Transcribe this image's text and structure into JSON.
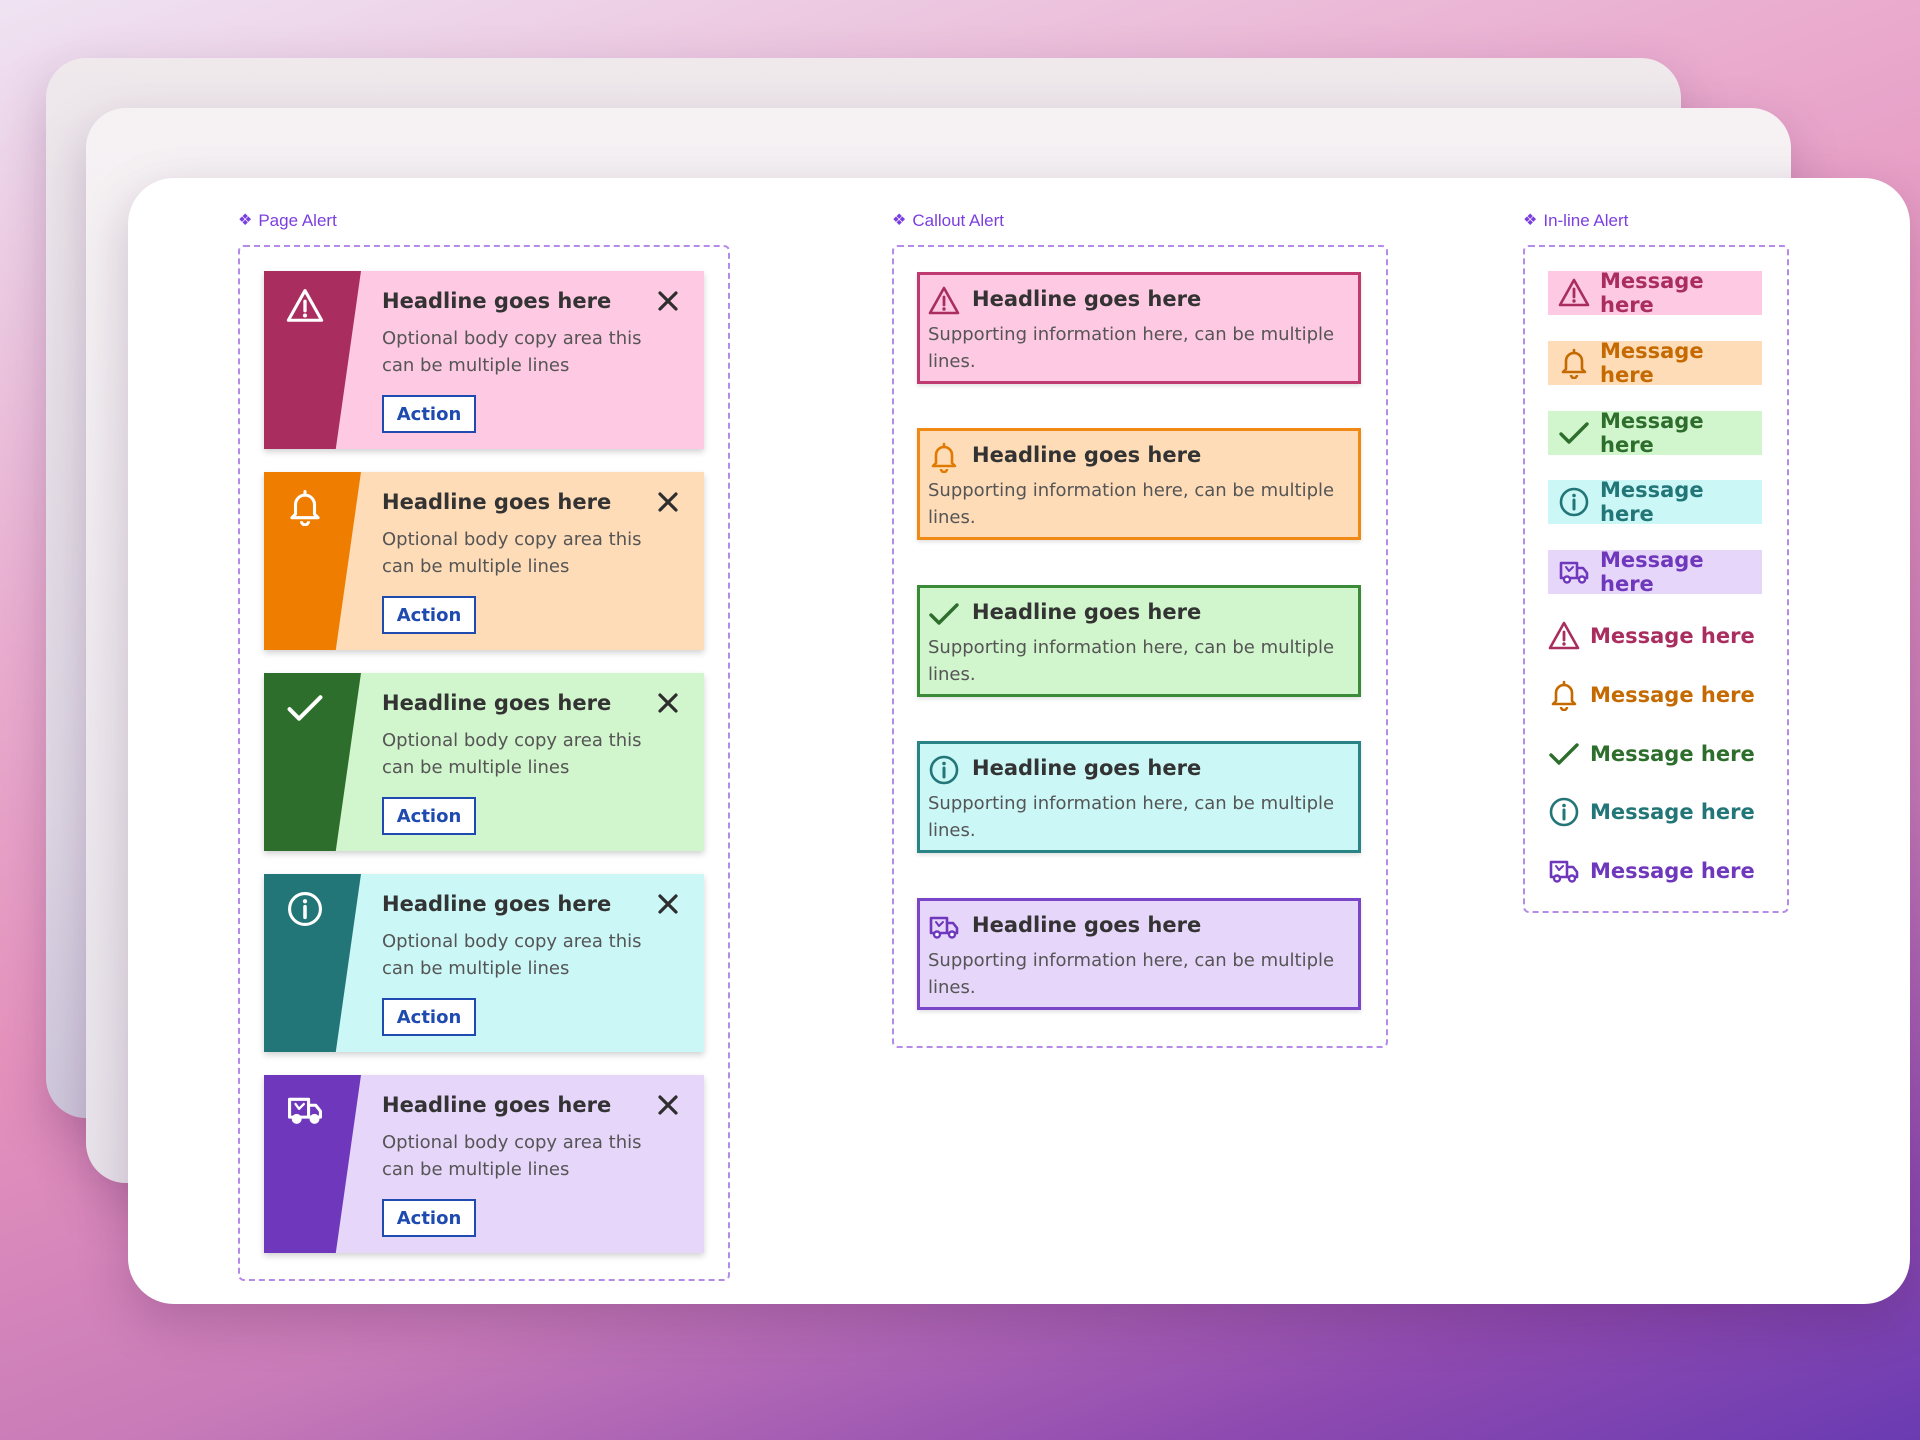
{
  "sections": {
    "page_alert": "Page Alert",
    "callout_alert": "Callout Alert",
    "inline_alert": "In-line Alert"
  },
  "page_alerts": [
    {
      "headline": "Headline goes here",
      "body": "Optional body copy area this can be multiple lines",
      "action": "Action",
      "icon": "warning-icon",
      "accent": "#a92e5f",
      "bg": "#fec9e2"
    },
    {
      "headline": "Headline goes here",
      "body": "Optional body copy area this can be multiple lines",
      "action": "Action",
      "icon": "bell-icon",
      "accent": "#ef7d00",
      "bg": "#fedcb8"
    },
    {
      "headline": "Headline goes here",
      "body": "Optional body copy area this can be multiple lines",
      "action": "Action",
      "icon": "check-icon",
      "accent": "#2e6e2d",
      "bg": "#d1f5cc"
    },
    {
      "headline": "Headline goes here",
      "body": "Optional body copy area this can be multiple lines",
      "action": "Action",
      "icon": "info-icon",
      "accent": "#237677",
      "bg": "#cbf7f7"
    },
    {
      "headline": "Headline goes here",
      "body": "Optional body copy area this can be multiple lines",
      "action": "Action",
      "icon": "truck-icon",
      "accent": "#6f37bb",
      "bg": "#e6d6fa"
    }
  ],
  "callout_alerts": [
    {
      "headline": "Headline goes here",
      "body": "Supporting information here, can be multiple lines.",
      "icon": "warning-icon",
      "border": "#c03a72",
      "icon_color": "#a92e5f",
      "bg": "#fec9e2"
    },
    {
      "headline": "Headline goes here",
      "body": "Supporting information here, can be multiple lines.",
      "icon": "bell-icon",
      "border": "#f08a14",
      "icon_color": "#e07a00",
      "bg": "#fedcb8"
    },
    {
      "headline": "Headline goes here",
      "body": "Supporting information here, can be multiple lines.",
      "icon": "check-icon",
      "border": "#3a8a38",
      "icon_color": "#2e6e2d",
      "bg": "#d1f5cc"
    },
    {
      "headline": "Headline goes here",
      "body": "Supporting information here, can be multiple lines.",
      "icon": "info-icon",
      "border": "#2a8384",
      "icon_color": "#237677",
      "bg": "#cbf7f7"
    },
    {
      "headline": "Headline goes here",
      "body": "Supporting information here, can be multiple lines.",
      "icon": "truck-icon",
      "border": "#7a45c8",
      "icon_color": "#6f37bb",
      "bg": "#e6d6fa"
    }
  ],
  "inline_alerts": [
    {
      "message": "Message here",
      "icon": "warning-icon",
      "color": "#a92e5f",
      "bg": "#fec9e2",
      "filled": true
    },
    {
      "message": "Message here",
      "icon": "bell-icon",
      "color": "#c46a00",
      "bg": "#fedcb8",
      "filled": true
    },
    {
      "message": "Message here",
      "icon": "check-icon",
      "color": "#2e6e2d",
      "bg": "#d1f5cc",
      "filled": true
    },
    {
      "message": "Message here",
      "icon": "info-icon",
      "color": "#237677",
      "bg": "#cbf7f7",
      "filled": true
    },
    {
      "message": "Message here",
      "icon": "truck-icon",
      "color": "#6f37bb",
      "bg": "#e6d6fa",
      "filled": true
    },
    {
      "message": "Message here",
      "icon": "warning-icon",
      "color": "#a92e5f",
      "bg": "",
      "filled": false
    },
    {
      "message": "Message here",
      "icon": "bell-icon",
      "color": "#c46a00",
      "bg": "",
      "filled": false
    },
    {
      "message": "Message here",
      "icon": "check-icon",
      "color": "#2e6e2d",
      "bg": "",
      "filled": false
    },
    {
      "message": "Message here",
      "icon": "info-icon",
      "color": "#237677",
      "bg": "",
      "filled": false
    },
    {
      "message": "Message here",
      "icon": "truck-icon",
      "color": "#6f37bb",
      "bg": "",
      "filled": false
    }
  ]
}
